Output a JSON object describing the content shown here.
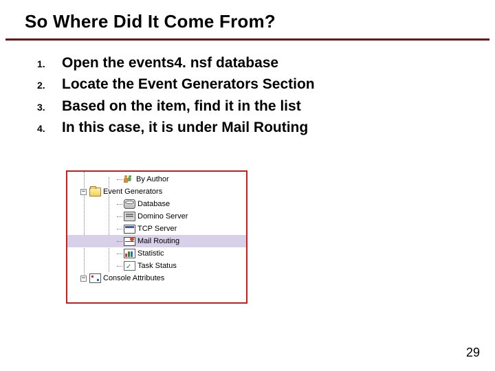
{
  "title": "So Where Did It Come From?",
  "steps": [
    "Open the events4. nsf database",
    "Locate the Event Generators Section",
    "Based on the item, find it in the list",
    "In this case, it is under Mail Routing"
  ],
  "tree": {
    "minus": "−",
    "nodes": [
      {
        "label": "By Author",
        "icon": "people-icon",
        "indent": 72,
        "twig": 8,
        "collapse": false,
        "selected": false
      },
      {
        "label": "Event Generators",
        "icon": "folder-open-icon",
        "indent": 32,
        "twig": 6,
        "collapse": true,
        "selected": false
      },
      {
        "label": "Database",
        "icon": "database-icon",
        "indent": 72,
        "twig": 8,
        "collapse": false,
        "selected": false
      },
      {
        "label": "Domino Server",
        "icon": "server-icon",
        "indent": 72,
        "twig": 8,
        "collapse": false,
        "selected": false
      },
      {
        "label": "TCP Server",
        "icon": "tcp-icon",
        "indent": 72,
        "twig": 8,
        "collapse": false,
        "selected": false
      },
      {
        "label": "Mail Routing",
        "icon": "mail-icon",
        "indent": 72,
        "twig": 8,
        "collapse": false,
        "selected": true
      },
      {
        "label": "Statistic",
        "icon": "statistic-icon",
        "indent": 72,
        "twig": 8,
        "collapse": false,
        "selected": false
      },
      {
        "label": "Task Status",
        "icon": "task-icon",
        "indent": 72,
        "twig": 8,
        "collapse": false,
        "selected": false
      },
      {
        "label": "Console Attributes",
        "icon": "console-icon",
        "indent": 32,
        "twig": 6,
        "collapse": true,
        "selected": false
      }
    ]
  },
  "page_number": "29"
}
